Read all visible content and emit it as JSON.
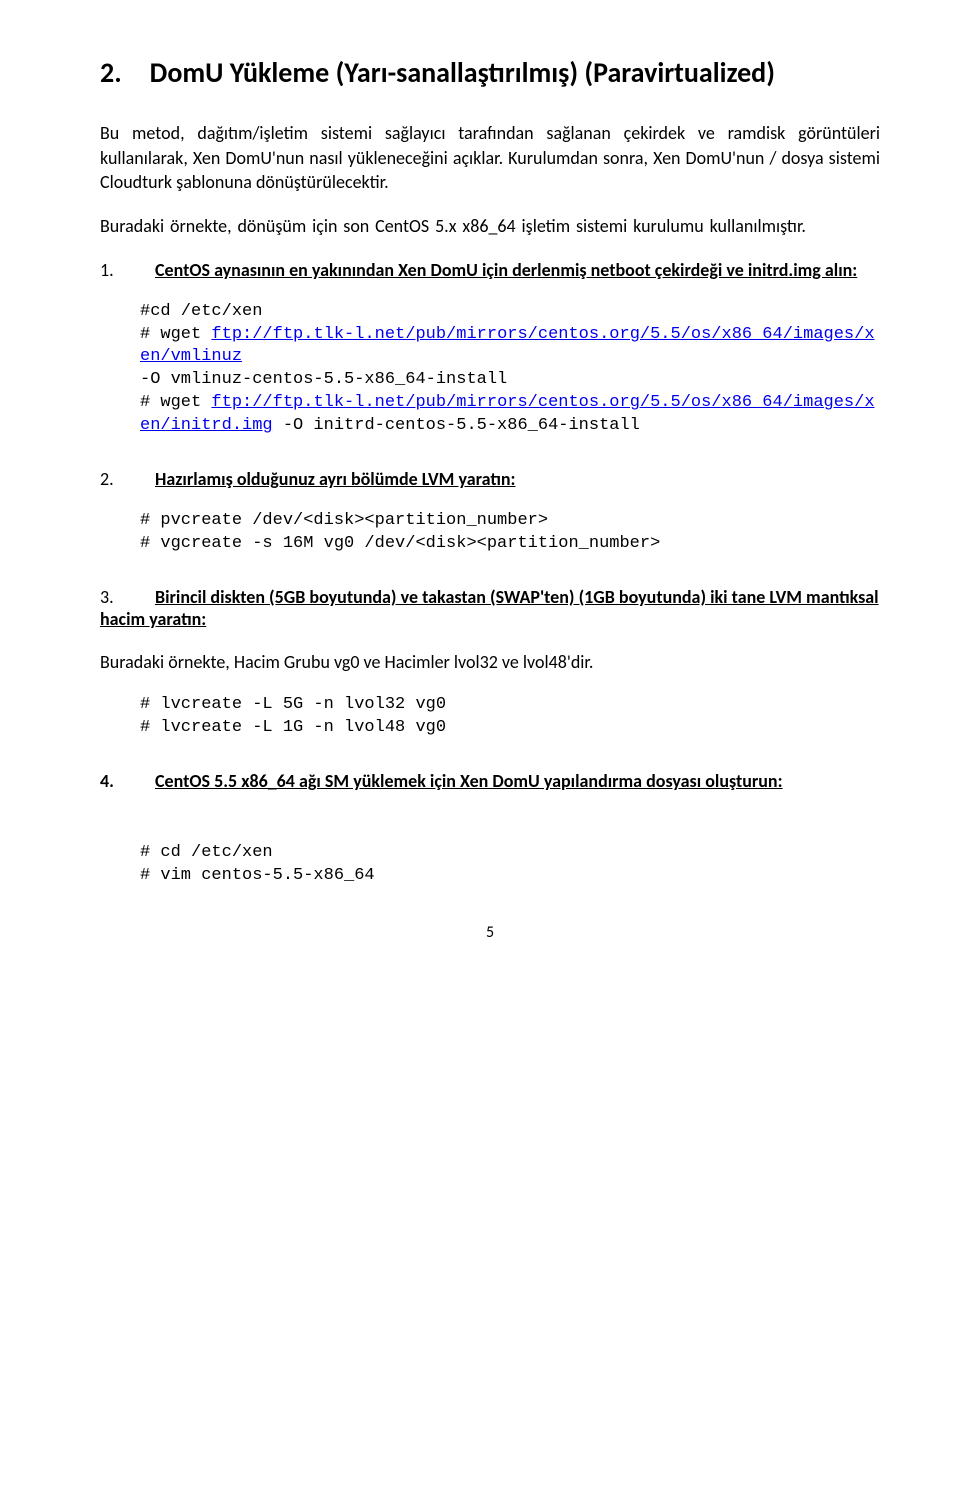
{
  "heading": "2. DomU Yükleme (Yarı-sanallaştırılmış) (Paravirtualized)",
  "p1": "Bu metod, dağıtım/işletim sistemi sağlayıcı tarafından sağlanan çekirdek ve ramdisk görüntüleri kullanılarak, Xen DomU'nun nasıl yükleneceğini açıklar. Kurulumdan sonra, Xen DomU'nun / dosya sistemi Cloudturk şablonuna dönüştürülecektir.",
  "p2": "Buradaki örnekte, dönüşüm için son CentOS 5.x x86_64 işletim sistemi kurulumu kullanılmıştır.",
  "step1": {
    "num": "1.",
    "txt": "CentOS aynasının en yakınından Xen DomU için derlenmiş netboot çekirdeği ve initrd.img alın:"
  },
  "code1_l1": "#cd /etc/xen",
  "code1_l2a": "# wget ",
  "code1_l2link": "ftp://ftp.tlk-l.net/pub/mirrors/centos.org/5.5/os/x86_64/images/xen/vmlinuz",
  "code1_l3": "-O vmlinuz-centos-5.5-x86_64-install",
  "code1_l4a": "# wget ",
  "code1_l4link": "ftp://ftp.tlk-l.net/pub/mirrors/centos.org/5.5/os/x86_64/images/xen/initrd.img",
  "code1_l5": " -O initrd-centos-5.5-x86_64-install",
  "step2": {
    "num": "2.",
    "txt": "Hazırlamış olduğunuz ayrı bölümde LVM yaratın:"
  },
  "code2": "# pvcreate /dev/<disk><partition_number>\n# vgcreate -s 16M vg0 /dev/<disk><partition_number>",
  "step3": {
    "num": "3.",
    "txt": "Birincil diskten (5GB boyutunda) ve takastan (SWAP'ten) (1GB boyutunda) iki tane LVM mantıksal hacim yaratın:"
  },
  "p3": "Buradaki örnekte, Hacim Grubu vg0 ve Hacimler lvol32 ve lvol48'dir.",
  "code3": "# lvcreate -L 5G -n lvol32 vg0\n# lvcreate -L 1G -n lvol48 vg0",
  "step4": {
    "num": "4.",
    "txt": " CentOS 5.5 x86_64 ağı SM yüklemek için Xen DomU yapılandırma dosyası",
    "suffix": "oluşturun:"
  },
  "code4": "# cd /etc/xen\n# vim centos-5.5-x86_64",
  "pagenum": "5"
}
